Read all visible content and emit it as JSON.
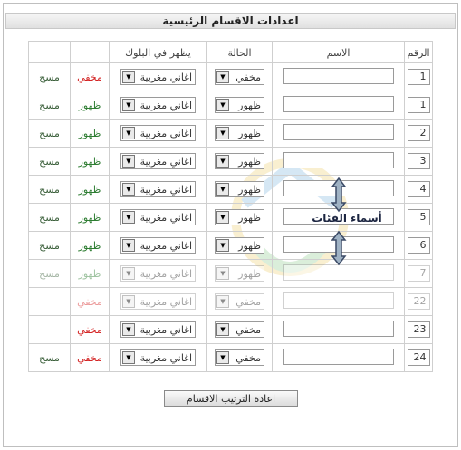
{
  "page": {
    "title": "اعدادات الاقسام الرئيسية"
  },
  "columns": {
    "number": "الرقم",
    "name": "الاسم",
    "status": "الحالة",
    "block": "يظهر في البلوك",
    "visibility": "",
    "delete": ""
  },
  "rows": [
    {
      "number": "1",
      "status": "مخفي",
      "block": "اغاني مغربية",
      "visibility": "مخفي",
      "vis_state": "hide",
      "delete": "مسح"
    },
    {
      "number": "1",
      "status": "ظهور",
      "block": "اغاني مغربية",
      "visibility": "ظهور",
      "vis_state": "show",
      "delete": "مسح"
    },
    {
      "number": "2",
      "status": "ظهور",
      "block": "اغاني مغربية",
      "visibility": "ظهور",
      "vis_state": "show",
      "delete": "مسح"
    },
    {
      "number": "3",
      "status": "ظهور",
      "block": "اغاني مغربية",
      "visibility": "ظهور",
      "vis_state": "show",
      "delete": "مسح"
    },
    {
      "number": "4",
      "status": "ظهور",
      "block": "اغاني مغربية",
      "visibility": "ظهور",
      "vis_state": "show",
      "delete": "مسح"
    },
    {
      "number": "5",
      "status": "ظهور",
      "block": "اغاني مغربية",
      "visibility": "ظهور",
      "vis_state": "show",
      "delete": "مسح"
    },
    {
      "number": "6",
      "status": "ظهور",
      "block": "اغاني مغربية",
      "visibility": "ظهور",
      "vis_state": "show",
      "delete": "مسح"
    },
    {
      "number": "7",
      "status": "ظهور",
      "block": "اغاني مغربية",
      "visibility": "ظهور",
      "vis_state": "show",
      "delete": "مسح",
      "faded": true
    },
    {
      "number": "22",
      "status": "مخفي",
      "block": "اغاني مغربية",
      "visibility": "مخفي",
      "vis_state": "hide",
      "delete": "",
      "faded": true
    },
    {
      "number": "23",
      "status": "مخفي",
      "block": "اغاني مغربية",
      "visibility": "مخفي",
      "vis_state": "hide",
      "delete": ""
    },
    {
      "number": "24",
      "status": "مخفي",
      "block": "اغاني مغربية",
      "visibility": "مخفي",
      "vis_state": "hide",
      "delete": "مسح"
    }
  ],
  "annotation": {
    "label": "أسماء الفئات"
  },
  "actions": {
    "reorder_label": "اعادة الترتيب الاقسام"
  },
  "colors": {
    "show": "#2e7d32",
    "hide": "#d32020",
    "title_bg": "#e0e0e0"
  }
}
